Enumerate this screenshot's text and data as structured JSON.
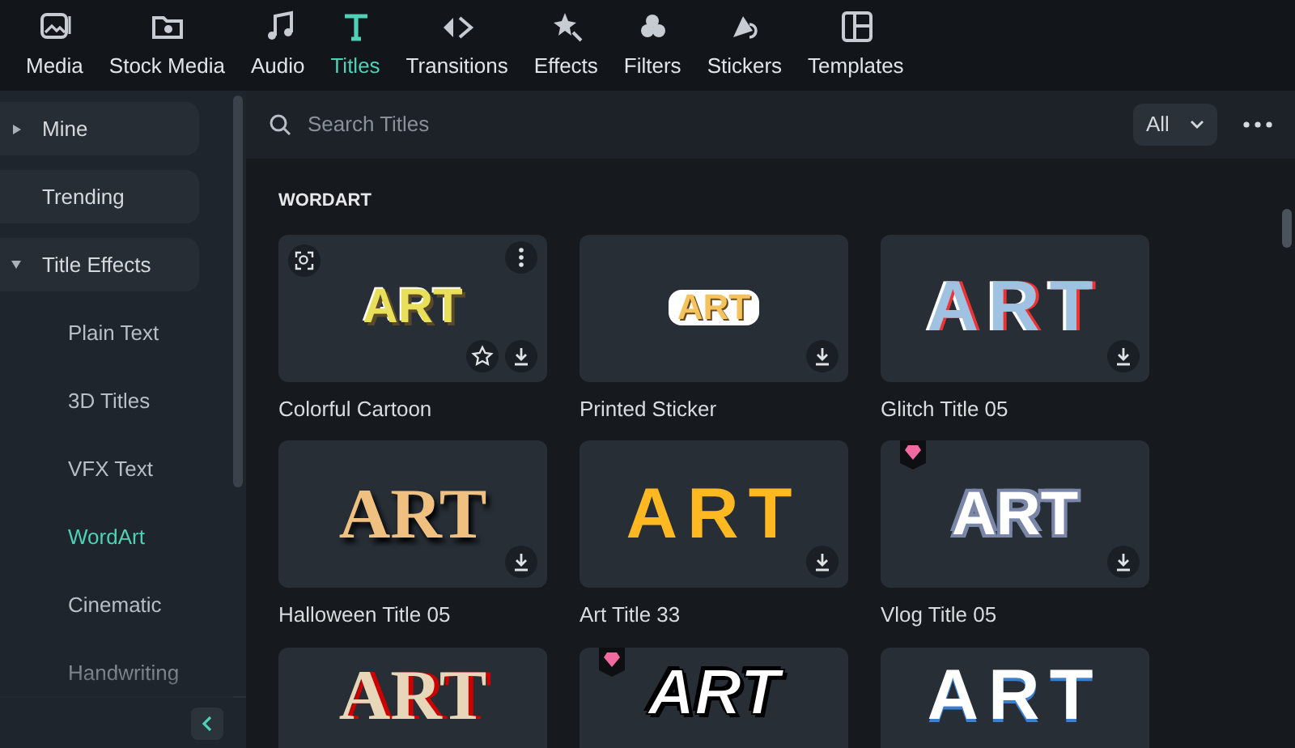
{
  "toolbar": {
    "tabs": [
      {
        "label": "Media",
        "selected": false
      },
      {
        "label": "Stock Media",
        "selected": false
      },
      {
        "label": "Audio",
        "selected": false
      },
      {
        "label": "Titles",
        "selected": true
      },
      {
        "label": "Transitions",
        "selected": false
      },
      {
        "label": "Effects",
        "selected": false
      },
      {
        "label": "Filters",
        "selected": false
      },
      {
        "label": "Stickers",
        "selected": false
      },
      {
        "label": "Templates",
        "selected": false
      }
    ]
  },
  "sidebar": {
    "items": [
      {
        "label": "Mine",
        "kind": "group",
        "expanded": false
      },
      {
        "label": "Trending",
        "kind": "link"
      },
      {
        "label": "Title Effects",
        "kind": "group",
        "expanded": true,
        "children": [
          {
            "label": "Plain Text",
            "selected": false
          },
          {
            "label": "3D Titles",
            "selected": false
          },
          {
            "label": "VFX Text",
            "selected": false
          },
          {
            "label": "WordArt",
            "selected": true
          },
          {
            "label": "Cinematic",
            "selected": false
          },
          {
            "label": "Handwriting",
            "selected": false
          }
        ]
      }
    ]
  },
  "search": {
    "placeholder": "Search Titles"
  },
  "filter": {
    "value": "All"
  },
  "section": {
    "title": "WORDART"
  },
  "cards": [
    {
      "name": "Colorful Cartoon",
      "preview_text": "ART",
      "premium": false,
      "hovered": true
    },
    {
      "name": "Printed Sticker",
      "preview_text": "ART",
      "premium": false,
      "hovered": false
    },
    {
      "name": "Glitch Title 05",
      "preview_text": "ART",
      "premium": false,
      "hovered": false
    },
    {
      "name": "Halloween Title 05",
      "preview_text": "ART",
      "premium": false,
      "hovered": false
    },
    {
      "name": "Art Title 33",
      "preview_text": "ART",
      "premium": false,
      "hovered": false
    },
    {
      "name": "Vlog Title 05",
      "preview_text": "ART",
      "premium": true,
      "hovered": false
    },
    {
      "preview_text": "ART",
      "premium": false,
      "hovered": false
    },
    {
      "preview_text": "ART",
      "premium": true,
      "hovered": false
    },
    {
      "preview_text": "ART",
      "premium": false,
      "hovered": false
    }
  ]
}
